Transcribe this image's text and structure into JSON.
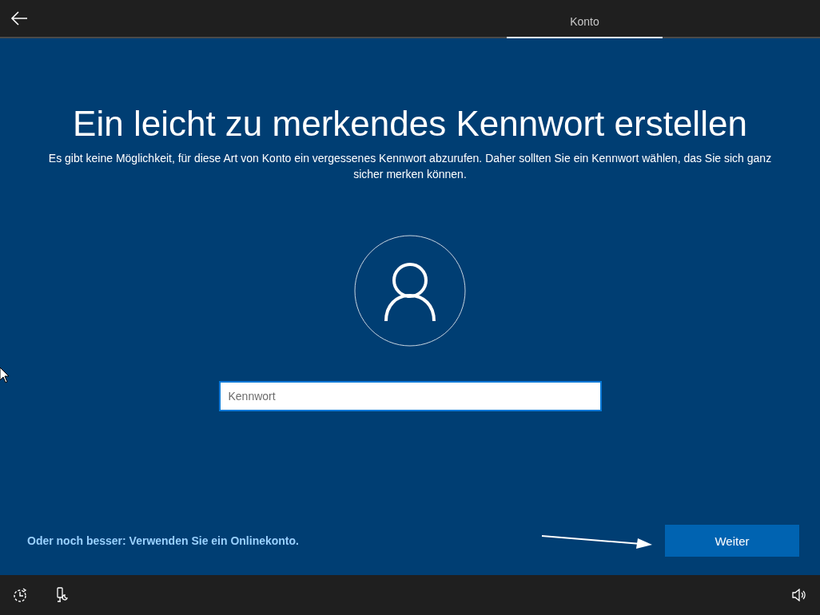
{
  "tabs": [
    {
      "label": "Konto",
      "selected": true
    }
  ],
  "heading": "Ein leicht zu merkendes Kennwort erstellen",
  "description": "Es gibt keine Möglichkeit, für diese Art von Konto ein vergessenes Kennwort abzurufen. Daher sollten Sie ein Kennwort wählen, das Sie sich ganz sicher merken können.",
  "password_field": {
    "placeholder": "Kennwort"
  },
  "online_account_link": "Oder noch besser: Verwenden Sie ein Onlinekonto.",
  "next_button": "Weiter"
}
